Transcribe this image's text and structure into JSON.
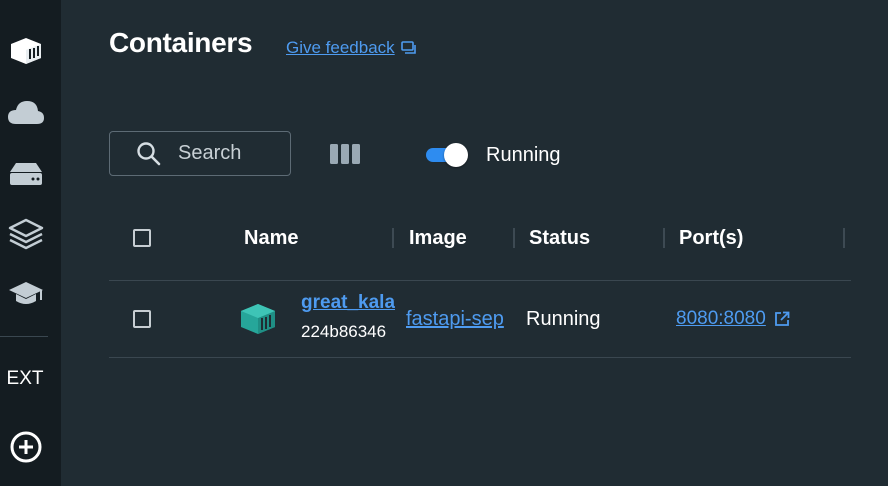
{
  "sidebar": {
    "items": [
      {
        "icon": "containers-icon"
      },
      {
        "icon": "cloud-icon"
      },
      {
        "icon": "storage-drive-icon"
      },
      {
        "icon": "layers-icon"
      },
      {
        "icon": "graduation-cap-icon"
      }
    ],
    "ext_label": "EXT",
    "add_icon": "add-circle-icon"
  },
  "header": {
    "title": "Containers",
    "feedback_label": "Give feedback",
    "feedback_icon": "chat-icon"
  },
  "toolbar": {
    "search_placeholder": "Search",
    "columns_icon": "columns-icon",
    "toggle_label": "Running",
    "toggle_on": true
  },
  "table": {
    "headers": [
      "Name",
      "Image",
      "Status",
      "Port(s)"
    ],
    "rows": [
      {
        "name": "great_kala",
        "id": "224b86346",
        "image": "fastapi-sep",
        "status": "Running",
        "port": "8080:8080"
      }
    ]
  },
  "colors": {
    "accent": "#2e8cf0",
    "link": "#4e9bf0",
    "container_icon": "#26a69a",
    "background": "#202c33",
    "sidebar": "#141c21"
  }
}
